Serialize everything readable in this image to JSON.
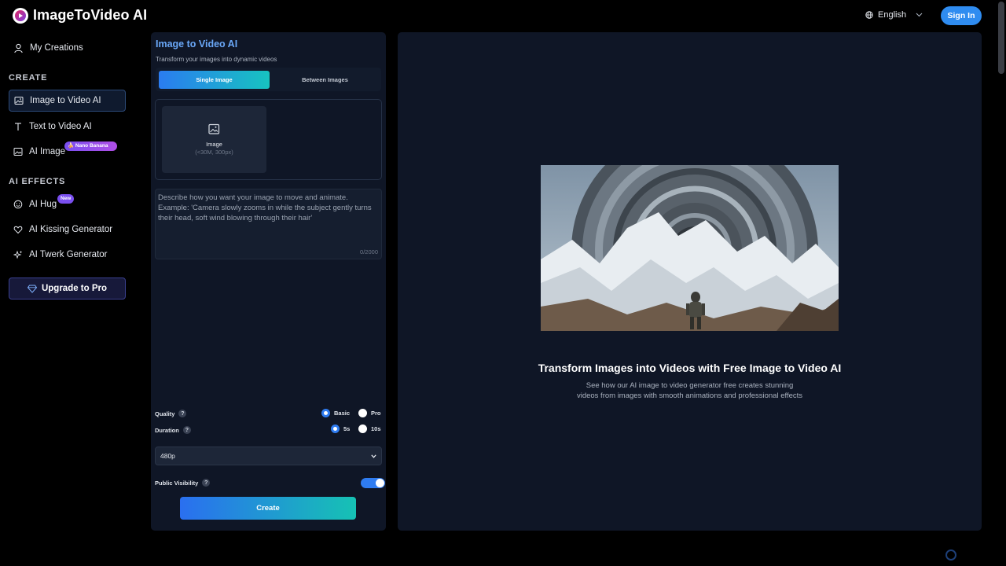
{
  "header": {
    "logo_text": "ImageToVideo AI",
    "language": "English",
    "signin_label": "Sign In"
  },
  "sidebar": {
    "my_creations": "My Creations",
    "create_heading": "CREATE",
    "create_items": [
      {
        "label": "Image to Video AI",
        "icon": "image-icon",
        "active": true
      },
      {
        "label": "Text to Video AI",
        "icon": "text-icon",
        "active": false
      },
      {
        "label": "AI Image",
        "icon": "picture-icon",
        "active": false,
        "badge": "Nano Banana"
      }
    ],
    "effects_heading": "AI EFFECTS",
    "effects_items": [
      {
        "label": "AI Hug",
        "icon": "smile-icon",
        "badge": "New"
      },
      {
        "label": "AI Kissing Generator",
        "icon": "heart-icon"
      },
      {
        "label": "AI Twerk Generator",
        "icon": "sparkles-icon"
      }
    ],
    "upgrade_label": "Upgrade to Pro"
  },
  "form": {
    "title": "Image to Video AI",
    "subtitle": "Transform your images into dynamic videos",
    "tabs": [
      "Single Image",
      "Between Images"
    ],
    "upload_label": "Image",
    "upload_hint": "(<30M, 300px)",
    "prompt_placeholder": "Describe how you want your image to move and animate. Example: 'Camera slowly zooms in while the subject gently turns their head, soft wind blowing through their hair'",
    "prompt_counter": "0/2000",
    "quality_label": "Quality",
    "quality_options": [
      "Basic",
      "Pro"
    ],
    "quality_selected": "Basic",
    "duration_label": "Duration",
    "duration_options": [
      "5s",
      "10s"
    ],
    "duration_selected": "5s",
    "resolution_value": "480p",
    "visibility_label": "Public Visibility",
    "visibility_on": true,
    "create_label": "Create"
  },
  "preview": {
    "title": "Transform Images into Videos with Free Image to Video AI",
    "description": "See how our AI image to video generator free creates stunning videos from images with smooth animations and professional effects"
  },
  "colors": {
    "accent": "#2f8cf0",
    "panel_bg": "#0f1626",
    "gradient_start": "#2a6ff0",
    "gradient_end": "#16c2b4"
  }
}
